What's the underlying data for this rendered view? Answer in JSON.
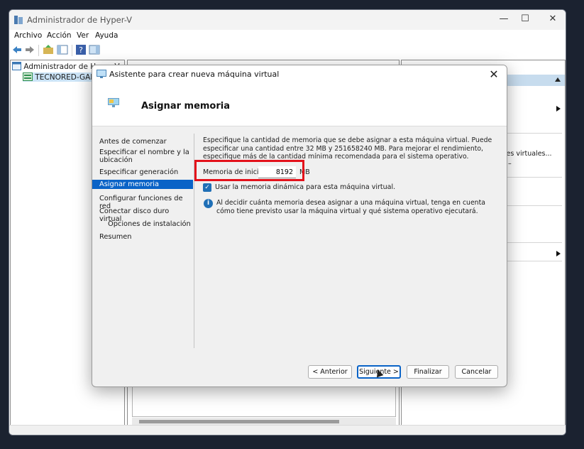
{
  "window": {
    "title": "Administrador de Hyper-V",
    "minimize": "—",
    "maximize": "☐",
    "close": "✕"
  },
  "menu": [
    "Archivo",
    "Acción",
    "Ver",
    "Ayuda"
  ],
  "tree": {
    "root": "Administrador de Hyper-V",
    "server": "TECNORED-GAME"
  },
  "actions_pane": {
    "partial_item": "ores virtuales...",
    "dash": "–"
  },
  "dialog": {
    "title": "Asistente para crear nueva máquina virtual",
    "close": "✕",
    "heading": "Asignar memoria",
    "steps": [
      "Antes de comenzar",
      "Especificar el nombre y la ubicación",
      "Especificar generación",
      "Asignar memoria",
      "Configurar funciones de red",
      "Conectar disco duro virtual",
      "Opciones de instalación",
      "Resumen"
    ],
    "description": "Especifique la cantidad de memoria que se debe asignar a esta máquina virtual. Puede especificar una cantidad entre 32 MB y 251658240 MB. Para mejorar el rendimiento, especifique más de la cantidad mínima recomendada para el sistema operativo.",
    "memory_label": "Memoria de inicio:",
    "memory_value": "8192",
    "memory_unit": "MB",
    "dynamic_memory_label": "Usar la memoria dinámica para esta máquina virtual.",
    "dynamic_memory_checked": true,
    "info_text": "Al decidir cuánta memoria desea asignar a una máquina virtual, tenga en cuenta cómo tiene previsto usar la máquina virtual y qué sistema operativo ejecutará.",
    "buttons": {
      "previous": "< Anterior",
      "next": "Siguiente >",
      "finish": "Finalizar",
      "cancel": "Cancelar"
    }
  },
  "colors": {
    "accent": "#0a63c7",
    "highlight_box": "#e3121b",
    "checkbox": "#1f6fb6"
  }
}
